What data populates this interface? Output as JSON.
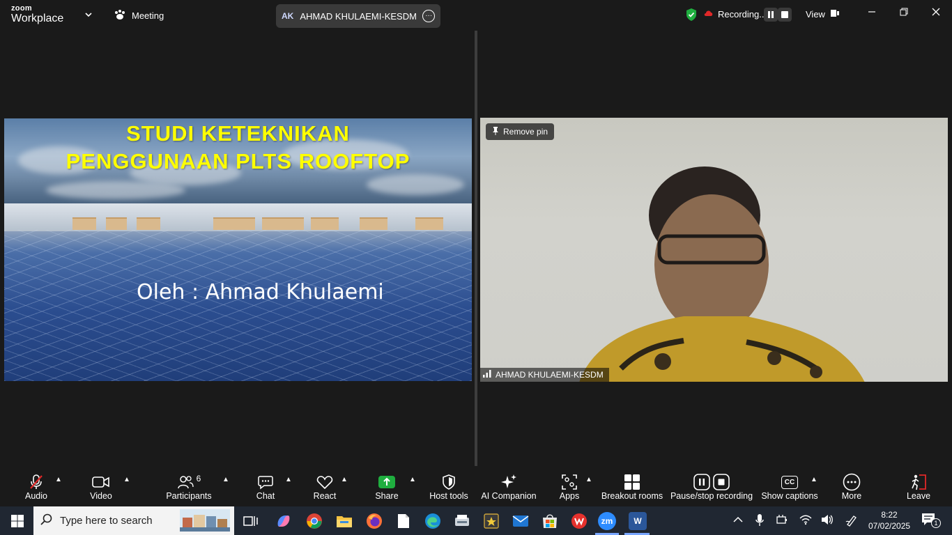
{
  "app": {
    "brand_small": "zoom",
    "brand_large": "Workplace"
  },
  "topbar": {
    "meeting_label": "Meeting",
    "share_initials": "AK",
    "share_title": "AHMAD KHULAEMI-KESDM's screen",
    "recording_label": "Recording...",
    "view_label": "View"
  },
  "slide": {
    "title_line1": "STUDI KETEKNIKAN",
    "title_line2": "PENGGUNAAN PLTS ROOFTOP",
    "author": "Oleh : Ahmad Khulaemi"
  },
  "video": {
    "remove_pin_label": "Remove pin",
    "participant_name": "AHMAD KHULAEMI-KESDM"
  },
  "toolbar": {
    "audio": "Audio",
    "video": "Video",
    "participants": "Participants",
    "participants_count": "6",
    "chat": "Chat",
    "react": "React",
    "share": "Share",
    "host_tools": "Host tools",
    "ai_companion": "AI Companion",
    "apps": "Apps",
    "breakout_rooms": "Breakout rooms",
    "pause_stop_recording": "Pause/stop recording",
    "show_captions": "Show captions",
    "captions_icon_text": "CC",
    "more": "More",
    "leave": "Leave"
  },
  "taskbar": {
    "search_placeholder": "Type here to search",
    "time": "8:22",
    "date": "07/02/2025",
    "notification_count": "1",
    "zoom_label": "zm",
    "word_label": "W"
  },
  "colors": {
    "accent_green": "#1fae3f",
    "recording_red": "#e02828",
    "slide_title_yellow": "#ffff00",
    "leave_red": "#e02828"
  }
}
